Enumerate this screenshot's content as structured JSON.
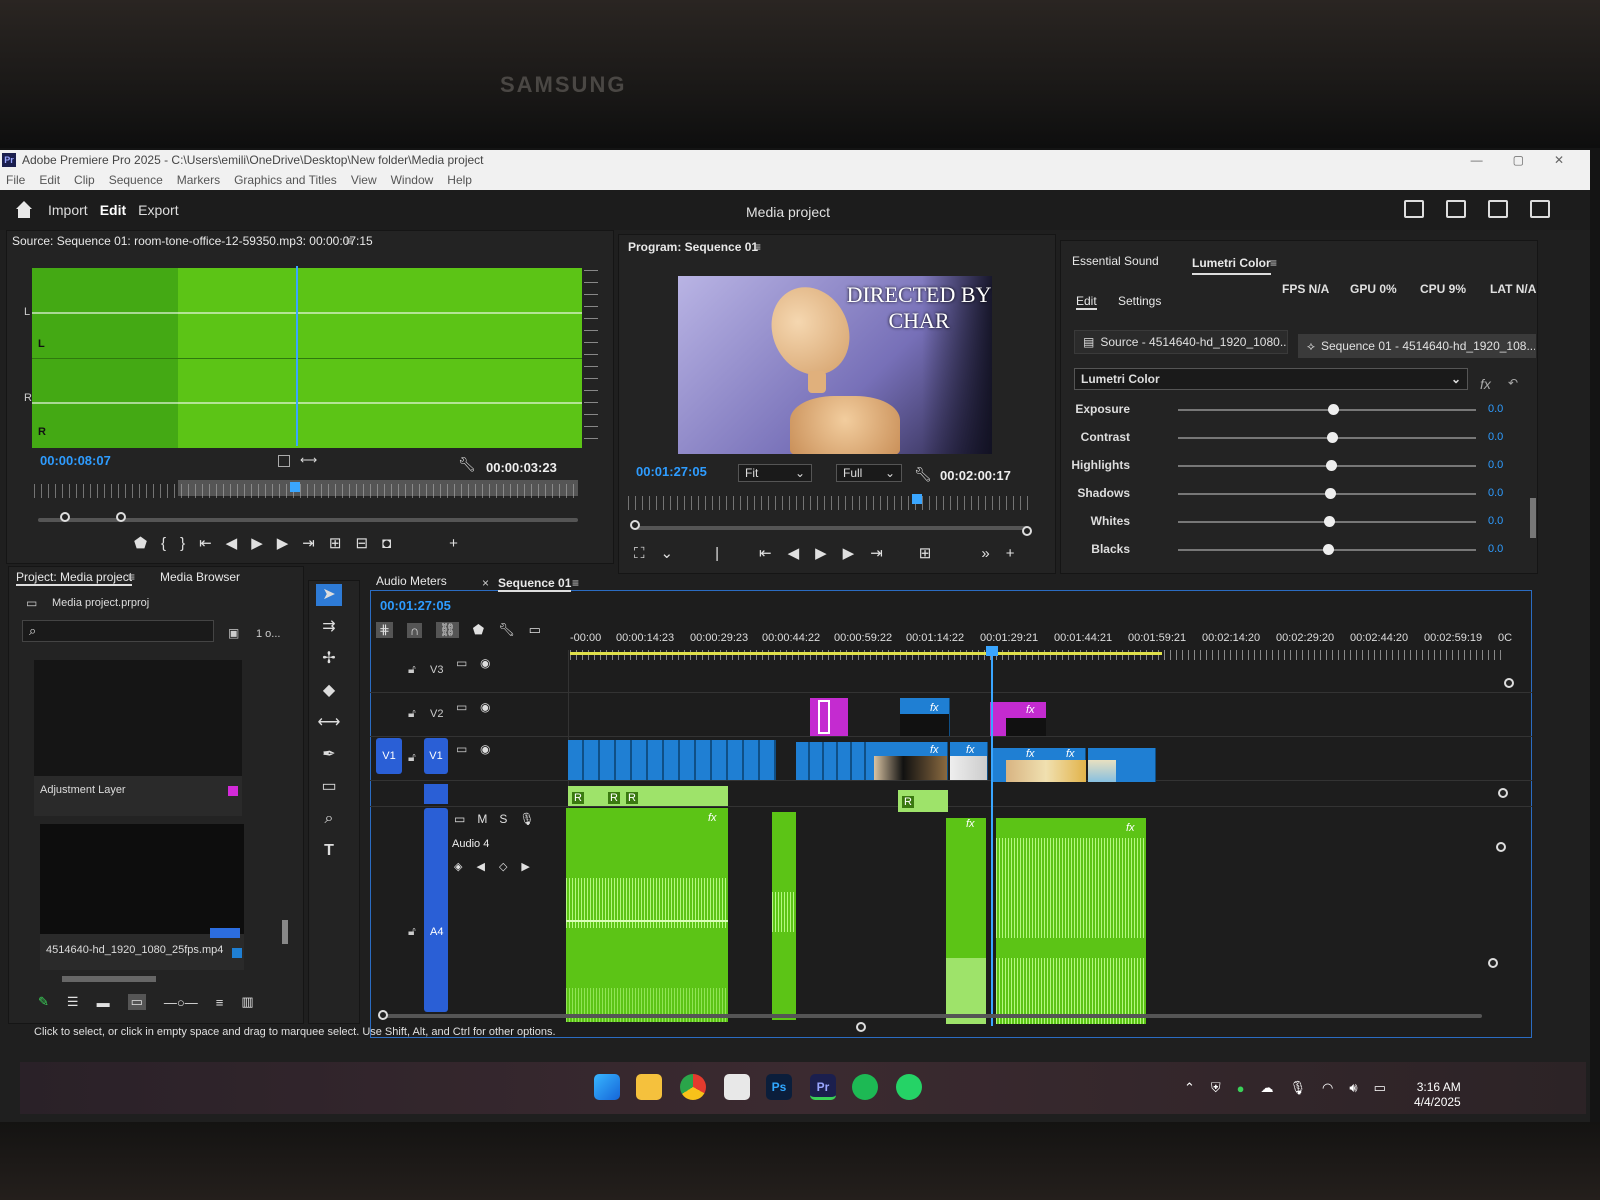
{
  "monitor": {
    "brand": "SAMSUNG"
  },
  "window": {
    "title": "Adobe Premiere Pro 2025 - C:\\Users\\emili\\OneDrive\\Desktop\\New folder\\Media project",
    "menu": [
      "File",
      "Edit",
      "Clip",
      "Sequence",
      "Markers",
      "Graphics and Titles",
      "View",
      "Window",
      "Help"
    ]
  },
  "workspace": {
    "tabs": [
      "Import",
      "Edit",
      "Export"
    ],
    "active": "Edit",
    "project_title": "Media project"
  },
  "source_monitor": {
    "title": "Source: Sequence 01: room-tone-office-12-59350.mp3: 00:00:07:15",
    "channel_labels": [
      "L",
      "L",
      "R",
      "R"
    ],
    "timecode_in": "00:00:08:07",
    "duration": "00:00:03:23"
  },
  "program_monitor": {
    "title": "Program: Sequence 01",
    "overlay_text": "DIRECTED BY\nCHAR",
    "timecode": "00:01:27:05",
    "zoom": "Fit",
    "resolution": "Full",
    "duration": "00:02:00:17"
  },
  "lumetri": {
    "tabs": [
      "Essential Sound",
      "Lumetri Color"
    ],
    "subtabs": [
      "Edit",
      "Settings"
    ],
    "stats": [
      "FPS N/A",
      "GPU 0%",
      "CPU 9%",
      "LAT N/A"
    ],
    "source_btn": "Source - 4514640-hd_1920_1080...",
    "sequence_btn": "Sequence 01 - 4514640-hd_1920_108...",
    "effect": "Lumetri Color",
    "sliders": [
      {
        "label": "Exposure",
        "value": "0.0"
      },
      {
        "label": "Contrast",
        "value": "0.0"
      },
      {
        "label": "Highlights",
        "value": "0.0"
      },
      {
        "label": "Shadows",
        "value": "0.0"
      },
      {
        "label": "Whites",
        "value": "0.0"
      },
      {
        "label": "Blacks",
        "value": "0.0"
      }
    ]
  },
  "project_panel": {
    "tabs": [
      "Project: Media project",
      "Media Browser"
    ],
    "file": "Media project.prproj",
    "item_count": "1 o...",
    "items": [
      {
        "name": "Adjustment Layer"
      },
      {
        "name": "4514640-hd_1920_1080_25fps.mp4"
      }
    ]
  },
  "timeline": {
    "tabs": [
      "Audio Meters",
      "Sequence 01"
    ],
    "timecode": "00:01:27:05",
    "ruler": [
      "-00:00",
      "00:00:14:23",
      "00:00:29:23",
      "00:00:44:22",
      "00:00:59:22",
      "00:01:14:22",
      "00:01:29:21",
      "00:01:44:21",
      "00:01:59:21",
      "00:02:14:20",
      "00:02:29:20",
      "00:02:44:20",
      "00:02:59:19",
      "0C"
    ],
    "tracks": {
      "v3": "V3",
      "v2": "V2",
      "v1": "V1",
      "v1_source": "V1",
      "a4": "A4",
      "audio_name": "Audio 4"
    }
  },
  "status_bar": "Click to select, or click in empty space and drag to marquee select. Use Shift, Alt, and Ctrl for other options.",
  "taskbar": {
    "time": "3:16 AM",
    "date": "4/4/2025"
  },
  "colors": {
    "accent": "#2e9cff",
    "audio_clip": "#5cc416",
    "video_clip": "#1f7fd3",
    "adjustment": "#c42bd0"
  }
}
